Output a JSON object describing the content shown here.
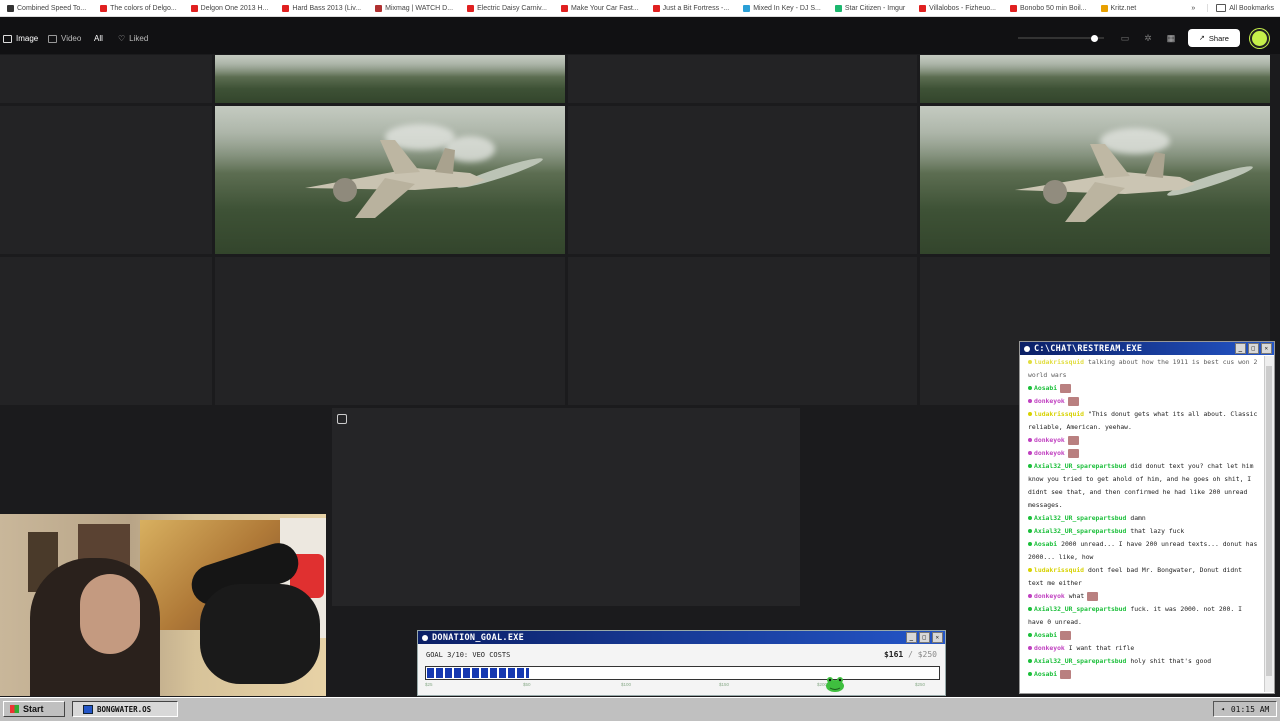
{
  "bookmarks": {
    "items": [
      {
        "label": "Combined Speed To...",
        "color": "#333333"
      },
      {
        "label": "The colors of Delgo...",
        "color": "#e02020"
      },
      {
        "label": "Delgon One 2013 H...",
        "color": "#e02020"
      },
      {
        "label": "Hard Bass 2013 (Liv...",
        "color": "#e02020"
      },
      {
        "label": "Mixmag | WATCH D...",
        "color": "#b03030"
      },
      {
        "label": "Electric Daisy Carniv...",
        "color": "#e02020"
      },
      {
        "label": "Make Your Car Fast...",
        "color": "#e02020"
      },
      {
        "label": "Just a Bit Fortress -...",
        "color": "#e02020"
      },
      {
        "label": "Mixed In Key - DJ S...",
        "color": "#2a9fd6"
      },
      {
        "label": "Star Citizen - Imgur",
        "color": "#1bb76e"
      },
      {
        "label": "Villalobos - Fizheuo...",
        "color": "#e02020"
      },
      {
        "label": "Bonobo 50 min Boil...",
        "color": "#e02020"
      },
      {
        "label": "Kritz.net",
        "color": "#e8a000"
      }
    ],
    "all_label": "All Bookmarks"
  },
  "toolbar": {
    "image_label": "Image",
    "video_label": "Video",
    "all_label": "All",
    "liked_label": "Liked",
    "share_label": "Share",
    "zoom_level": 0.88
  },
  "donation": {
    "title": "DONATION_GOAL.EXE",
    "goal_label": "GOAL 3/10: VEO COSTS",
    "current": "$161",
    "separator": "/",
    "target": "$250",
    "progress": 0.2,
    "ticks": [
      "$25",
      "$50",
      "$100",
      "$150",
      "$200",
      "$250"
    ]
  },
  "chat": {
    "title": "C:\\CHAT\\RESTREAM.EXE",
    "messages": [
      {
        "user": "ludakrissquid",
        "text": "talking about how the 1911 is best cus won 2 world wars",
        "color": "#d7d200",
        "emote": false,
        "faded": true
      },
      {
        "user": "Aosabi",
        "text": "",
        "color": "#1bbf3a",
        "emote": true
      },
      {
        "user": "donkeyok",
        "text": "",
        "color": "#c040c0",
        "emote": true
      },
      {
        "user": "ludakrissquid",
        "text": "\"This donut gets what its all about. Classic reliable, American. yeehaw.",
        "color": "#d7d200",
        "emote": false
      },
      {
        "user": "donkeyok",
        "text": "",
        "color": "#c040c0",
        "emote": true
      },
      {
        "user": "donkeyok",
        "text": "",
        "color": "#c040c0",
        "emote": true
      },
      {
        "user": "Axial32_UR_sparepartsbud",
        "text": "did donut text you? chat let him know you tried to get ahold of him, and he goes oh shit, I didnt see that, and then confirmed he had like 200 unread messages.",
        "color": "#1bbf3a",
        "emote": false
      },
      {
        "user": "Axial32_UR_sparepartsbud",
        "text": "damn",
        "color": "#1bbf3a",
        "emote": false
      },
      {
        "user": "Axial32_UR_sparepartsbud",
        "text": "that lazy fuck",
        "color": "#1bbf3a",
        "emote": false
      },
      {
        "user": "Aosabi",
        "text": "2000 unread... I have 200 unread texts... donut has 2000... like, how",
        "color": "#1bbf3a",
        "emote": false
      },
      {
        "user": "ludakrissquid",
        "text": "dont feel bad Mr. Bongwater, Donut didnt text me either",
        "color": "#d7d200",
        "emote": false
      },
      {
        "user": "donkeyok",
        "text": "what",
        "color": "#c040c0",
        "emote": true
      },
      {
        "user": "Axial32_UR_sparepartsbud",
        "text": "fuck. it was 2000. not 200. I have 0 unread.",
        "color": "#1bbf3a",
        "emote": false
      },
      {
        "user": "Aosabi",
        "text": "",
        "color": "#1bbf3a",
        "emote": true
      },
      {
        "user": "donkeyok",
        "text": "I want that rifle",
        "color": "#c040c0",
        "emote": false
      },
      {
        "user": "Axial32_UR_sparepartsbud",
        "text": "holy shit that's good",
        "color": "#1bbf3a",
        "emote": false
      },
      {
        "user": "Aosabi",
        "text": "",
        "color": "#1bbf3a",
        "emote": true
      }
    ]
  },
  "taskbar": {
    "start_label": "Start",
    "task_label": "BONGWATER.OS",
    "clock": "01:15 AM"
  }
}
